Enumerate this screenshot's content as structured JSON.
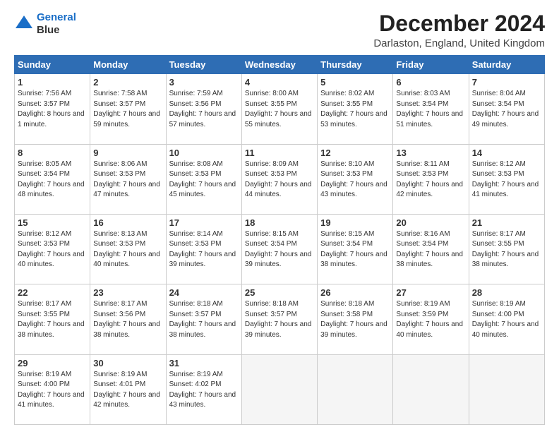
{
  "header": {
    "logo_line1": "General",
    "logo_line2": "Blue",
    "title": "December 2024",
    "subtitle": "Darlaston, England, United Kingdom"
  },
  "columns": [
    "Sunday",
    "Monday",
    "Tuesday",
    "Wednesday",
    "Thursday",
    "Friday",
    "Saturday"
  ],
  "weeks": [
    [
      {
        "num": "1",
        "sunrise": "Sunrise: 7:56 AM",
        "sunset": "Sunset: 3:57 PM",
        "daylight": "Daylight: 8 hours and 1 minute."
      },
      {
        "num": "2",
        "sunrise": "Sunrise: 7:58 AM",
        "sunset": "Sunset: 3:57 PM",
        "daylight": "Daylight: 7 hours and 59 minutes."
      },
      {
        "num": "3",
        "sunrise": "Sunrise: 7:59 AM",
        "sunset": "Sunset: 3:56 PM",
        "daylight": "Daylight: 7 hours and 57 minutes."
      },
      {
        "num": "4",
        "sunrise": "Sunrise: 8:00 AM",
        "sunset": "Sunset: 3:55 PM",
        "daylight": "Daylight: 7 hours and 55 minutes."
      },
      {
        "num": "5",
        "sunrise": "Sunrise: 8:02 AM",
        "sunset": "Sunset: 3:55 PM",
        "daylight": "Daylight: 7 hours and 53 minutes."
      },
      {
        "num": "6",
        "sunrise": "Sunrise: 8:03 AM",
        "sunset": "Sunset: 3:54 PM",
        "daylight": "Daylight: 7 hours and 51 minutes."
      },
      {
        "num": "7",
        "sunrise": "Sunrise: 8:04 AM",
        "sunset": "Sunset: 3:54 PM",
        "daylight": "Daylight: 7 hours and 49 minutes."
      }
    ],
    [
      {
        "num": "8",
        "sunrise": "Sunrise: 8:05 AM",
        "sunset": "Sunset: 3:54 PM",
        "daylight": "Daylight: 7 hours and 48 minutes."
      },
      {
        "num": "9",
        "sunrise": "Sunrise: 8:06 AM",
        "sunset": "Sunset: 3:53 PM",
        "daylight": "Daylight: 7 hours and 47 minutes."
      },
      {
        "num": "10",
        "sunrise": "Sunrise: 8:08 AM",
        "sunset": "Sunset: 3:53 PM",
        "daylight": "Daylight: 7 hours and 45 minutes."
      },
      {
        "num": "11",
        "sunrise": "Sunrise: 8:09 AM",
        "sunset": "Sunset: 3:53 PM",
        "daylight": "Daylight: 7 hours and 44 minutes."
      },
      {
        "num": "12",
        "sunrise": "Sunrise: 8:10 AM",
        "sunset": "Sunset: 3:53 PM",
        "daylight": "Daylight: 7 hours and 43 minutes."
      },
      {
        "num": "13",
        "sunrise": "Sunrise: 8:11 AM",
        "sunset": "Sunset: 3:53 PM",
        "daylight": "Daylight: 7 hours and 42 minutes."
      },
      {
        "num": "14",
        "sunrise": "Sunrise: 8:12 AM",
        "sunset": "Sunset: 3:53 PM",
        "daylight": "Daylight: 7 hours and 41 minutes."
      }
    ],
    [
      {
        "num": "15",
        "sunrise": "Sunrise: 8:12 AM",
        "sunset": "Sunset: 3:53 PM",
        "daylight": "Daylight: 7 hours and 40 minutes."
      },
      {
        "num": "16",
        "sunrise": "Sunrise: 8:13 AM",
        "sunset": "Sunset: 3:53 PM",
        "daylight": "Daylight: 7 hours and 40 minutes."
      },
      {
        "num": "17",
        "sunrise": "Sunrise: 8:14 AM",
        "sunset": "Sunset: 3:53 PM",
        "daylight": "Daylight: 7 hours and 39 minutes."
      },
      {
        "num": "18",
        "sunrise": "Sunrise: 8:15 AM",
        "sunset": "Sunset: 3:54 PM",
        "daylight": "Daylight: 7 hours and 39 minutes."
      },
      {
        "num": "19",
        "sunrise": "Sunrise: 8:15 AM",
        "sunset": "Sunset: 3:54 PM",
        "daylight": "Daylight: 7 hours and 38 minutes."
      },
      {
        "num": "20",
        "sunrise": "Sunrise: 8:16 AM",
        "sunset": "Sunset: 3:54 PM",
        "daylight": "Daylight: 7 hours and 38 minutes."
      },
      {
        "num": "21",
        "sunrise": "Sunrise: 8:17 AM",
        "sunset": "Sunset: 3:55 PM",
        "daylight": "Daylight: 7 hours and 38 minutes."
      }
    ],
    [
      {
        "num": "22",
        "sunrise": "Sunrise: 8:17 AM",
        "sunset": "Sunset: 3:55 PM",
        "daylight": "Daylight: 7 hours and 38 minutes."
      },
      {
        "num": "23",
        "sunrise": "Sunrise: 8:17 AM",
        "sunset": "Sunset: 3:56 PM",
        "daylight": "Daylight: 7 hours and 38 minutes."
      },
      {
        "num": "24",
        "sunrise": "Sunrise: 8:18 AM",
        "sunset": "Sunset: 3:57 PM",
        "daylight": "Daylight: 7 hours and 38 minutes."
      },
      {
        "num": "25",
        "sunrise": "Sunrise: 8:18 AM",
        "sunset": "Sunset: 3:57 PM",
        "daylight": "Daylight: 7 hours and 39 minutes."
      },
      {
        "num": "26",
        "sunrise": "Sunrise: 8:18 AM",
        "sunset": "Sunset: 3:58 PM",
        "daylight": "Daylight: 7 hours and 39 minutes."
      },
      {
        "num": "27",
        "sunrise": "Sunrise: 8:19 AM",
        "sunset": "Sunset: 3:59 PM",
        "daylight": "Daylight: 7 hours and 40 minutes."
      },
      {
        "num": "28",
        "sunrise": "Sunrise: 8:19 AM",
        "sunset": "Sunset: 4:00 PM",
        "daylight": "Daylight: 7 hours and 40 minutes."
      }
    ],
    [
      {
        "num": "29",
        "sunrise": "Sunrise: 8:19 AM",
        "sunset": "Sunset: 4:00 PM",
        "daylight": "Daylight: 7 hours and 41 minutes."
      },
      {
        "num": "30",
        "sunrise": "Sunrise: 8:19 AM",
        "sunset": "Sunset: 4:01 PM",
        "daylight": "Daylight: 7 hours and 42 minutes."
      },
      {
        "num": "31",
        "sunrise": "Sunrise: 8:19 AM",
        "sunset": "Sunset: 4:02 PM",
        "daylight": "Daylight: 7 hours and 43 minutes."
      },
      null,
      null,
      null,
      null
    ]
  ]
}
